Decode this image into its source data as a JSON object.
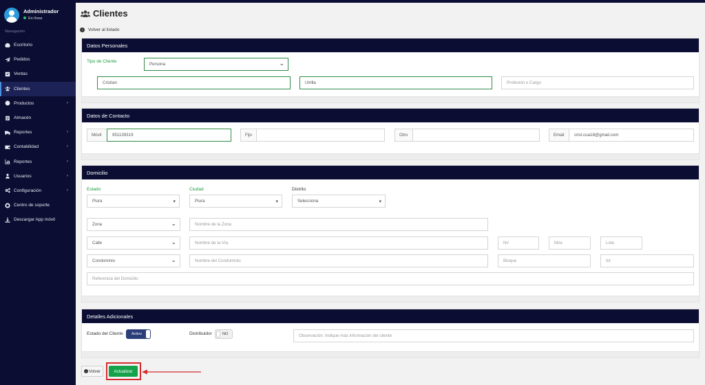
{
  "sidebar": {
    "user_name": "Administrador",
    "user_status": "En línea",
    "section_label": "Navegación",
    "items": [
      {
        "label": "Escritorio",
        "icon": "dashboard-icon",
        "chevron": false
      },
      {
        "label": "Pedidos",
        "icon": "paper-plane-icon",
        "chevron": false
      },
      {
        "label": "Ventas",
        "icon": "check-square-icon",
        "chevron": false
      },
      {
        "label": "Clientes",
        "icon": "users-icon",
        "chevron": false,
        "active": true
      },
      {
        "label": "Productos",
        "icon": "circle-icon",
        "chevron": true
      },
      {
        "label": "Almacén",
        "icon": "document-icon",
        "chevron": false
      },
      {
        "label": "Reportes",
        "icon": "truck-icon",
        "chevron": true
      },
      {
        "label": "Contabilidad",
        "icon": "wallet-icon",
        "chevron": true
      },
      {
        "label": "Reportes",
        "icon": "bar-chart-icon",
        "chevron": true
      },
      {
        "label": "Usuarios",
        "icon": "user-group-icon",
        "chevron": true
      },
      {
        "label": "Configuración",
        "icon": "cogs-icon",
        "chevron": true
      },
      {
        "label": "Centro de soporte",
        "icon": "life-ring-icon",
        "chevron": false
      },
      {
        "label": "Descargar App móvil",
        "icon": "download-icon",
        "chevron": false
      }
    ],
    "chevron_glyph": "›"
  },
  "page": {
    "title": "Clientes",
    "back_label": "Volver al listado"
  },
  "personal": {
    "heading": "Datos Personales",
    "tipo_label": "Tipo de Cliente",
    "tipo_value": "Persona",
    "first_name": "Cristian",
    "last_name": "Utrilla",
    "profession_placeholder": "Profesión o Cargo"
  },
  "contact": {
    "heading": "Datos de Contacto",
    "movil_label": "Móvil",
    "movil_value": "951139319",
    "fijo_label": "Fijo",
    "otro_label": "Otro",
    "email_label": "Email",
    "email_value": "crist.cua18@gmail.com"
  },
  "address": {
    "heading": "Domicilio",
    "estado_label": "Estado",
    "estado_value": "Piura",
    "ciudad_label": "Ciudad",
    "ciudad_value": "Piura",
    "distrito_label": "Distrito",
    "distrito_value": "Selecciona",
    "zona_type": "Zona",
    "zona_placeholder": "Nombre de la Zona",
    "calle_type": "Calle",
    "via_placeholder": "Nombre de la Vía",
    "nro_placeholder": "N#",
    "mza_placeholder": "Mza",
    "lote_placeholder": "Lote",
    "condo_type": "Condominio",
    "condo_placeholder": "Nombre del Condominio",
    "bloque_placeholder": "Bloque",
    "int_placeholder": "Int",
    "referencia_placeholder": "Referencia del Domicilio"
  },
  "extra": {
    "heading": "Detalles Adicionales",
    "estado_label": "Estado del Cliente",
    "estado_toggle": "Activo",
    "distribuidor_label": "Distribuidor",
    "distribuidor_toggle": "NO",
    "observacion_placeholder": "Observación: Indique más información del cliente"
  },
  "actions": {
    "back_label": "Volver",
    "back_icon_glyph": "‹",
    "update_label": "Actualizar"
  },
  "colors": {
    "sidebar_bg": "#0b0d33",
    "header_bg": "#0b0d33",
    "accent_green": "#14a34a",
    "label_green": "#1e9a3c",
    "highlight_red": "#d62b2b"
  }
}
